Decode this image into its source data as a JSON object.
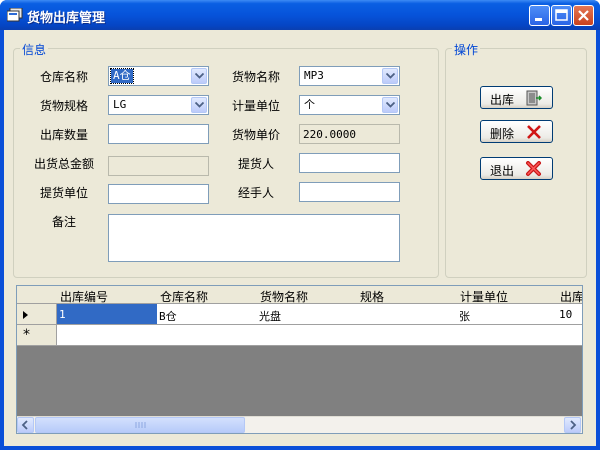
{
  "window": {
    "title": "货物出库管理",
    "accent_color": "#0a4fd8",
    "controls": [
      "minimize-icon",
      "maximize-icon",
      "close-icon"
    ]
  },
  "info_group": {
    "title": "信息",
    "warehouse": {
      "label": "仓库名称",
      "value": "A仓"
    },
    "goods_name": {
      "label": "货物名称",
      "value": "MP3"
    },
    "goods_spec": {
      "label": "货物规格",
      "value": "LG"
    },
    "unit": {
      "label": "计量单位",
      "value": "个"
    },
    "quantity": {
      "label": "出库数量",
      "value": ""
    },
    "unit_price": {
      "label": "货物单价",
      "value": "220.0000"
    },
    "total_amount": {
      "label": "出货总金额",
      "value": ""
    },
    "picker": {
      "label": "提货人",
      "value": ""
    },
    "picker_unit": {
      "label": "提货单位",
      "value": ""
    },
    "handler": {
      "label": "经手人",
      "value": ""
    },
    "remark": {
      "label": "备注",
      "value": ""
    }
  },
  "actions_group": {
    "title": "操作",
    "outbound_label": "出库",
    "delete_label": "删除",
    "exit_label": "退出"
  },
  "grid": {
    "columns": [
      "出库编号",
      "仓库名称",
      "货物名称",
      "规格",
      "计量单位",
      "出库"
    ],
    "rows": [
      [
        "1",
        "B仓",
        "光盘",
        "",
        "张",
        "10"
      ]
    ],
    "new_row_marker": "*"
  }
}
